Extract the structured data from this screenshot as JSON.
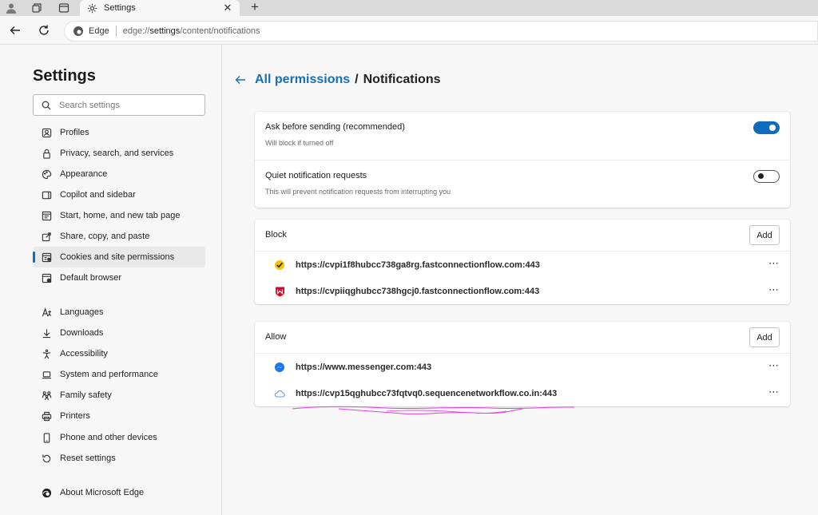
{
  "tab": {
    "title": "Settings"
  },
  "address": {
    "brand": "Edge",
    "url_prefix": "edge://",
    "url_bold": "settings",
    "url_suffix": "/content/notifications"
  },
  "sidebar": {
    "title": "Settings",
    "search_placeholder": "Search settings",
    "items": [
      {
        "label": "Profiles",
        "icon": "profile-icon"
      },
      {
        "label": "Privacy, search, and services",
        "icon": "lock-icon"
      },
      {
        "label": "Appearance",
        "icon": "palette-icon"
      },
      {
        "label": "Copilot and sidebar",
        "icon": "sidebar-icon"
      },
      {
        "label": "Start, home, and new tab page",
        "icon": "home-icon"
      },
      {
        "label": "Share, copy, and paste",
        "icon": "share-icon"
      },
      {
        "label": "Cookies and site permissions",
        "icon": "permissions-icon",
        "active": true
      },
      {
        "label": "Default browser",
        "icon": "browser-icon"
      },
      {
        "label": "Languages",
        "icon": "language-icon"
      },
      {
        "label": "Downloads",
        "icon": "download-icon"
      },
      {
        "label": "Accessibility",
        "icon": "accessibility-icon"
      },
      {
        "label": "System and performance",
        "icon": "laptop-icon"
      },
      {
        "label": "Family safety",
        "icon": "family-icon"
      },
      {
        "label": "Printers",
        "icon": "printer-icon"
      },
      {
        "label": "Phone and other devices",
        "icon": "phone-icon"
      },
      {
        "label": "Reset settings",
        "icon": "reset-icon"
      },
      {
        "label": "About Microsoft Edge",
        "icon": "edge-icon"
      }
    ]
  },
  "breadcrumb": {
    "parent": "All permissions",
    "separator": "/",
    "current": "Notifications"
  },
  "settings": [
    {
      "label": "Ask before sending (recommended)",
      "description": "Will block if turned off",
      "enabled": true
    },
    {
      "label": "Quiet notification requests",
      "description": "This will prevent notification requests from interrupting you",
      "enabled": false
    }
  ],
  "block": {
    "title": "Block",
    "add_label": "Add",
    "sites": [
      {
        "url": "https://cvpi1f8hubcc738ga8rg.fastconnectionflow.com:443",
        "icon": "norton-check-icon"
      },
      {
        "url": "https://cvpiiqghubcc738hgcj0.fastconnectionflow.com:443",
        "icon": "mcafee-shield-icon"
      }
    ]
  },
  "allow": {
    "title": "Allow",
    "add_label": "Add",
    "sites": [
      {
        "url": "https://www.messenger.com:443",
        "icon": "messenger-icon"
      },
      {
        "url": "https://cvp15qghubcc73fqtvq0.sequencenetworkflow.co.in:443",
        "icon": "cloud-icon"
      }
    ]
  },
  "colors": {
    "accent": "#0f6cbd",
    "link": "#1a6fb5",
    "scribble": "#e040e0"
  }
}
